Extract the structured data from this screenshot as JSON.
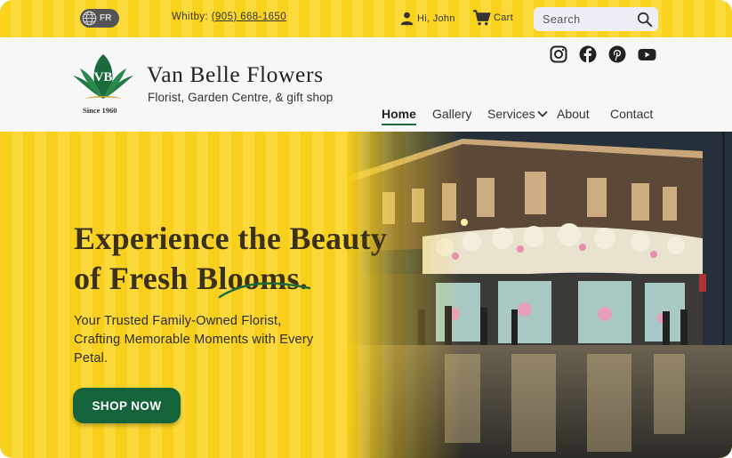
{
  "topbar": {
    "lang_label": "FR",
    "location": "Whitby:",
    "phone": "(905) 668-1650",
    "user_greeting": "Hi, John",
    "cart_label": "Cart",
    "search_placeholder": "Search"
  },
  "header": {
    "logo_initials": "VB",
    "since": "Since 1960",
    "brand": "Van Belle Flowers",
    "tagline": "Florist, Garden Centre, & gift shop",
    "socials": [
      "instagram-icon",
      "facebook-icon",
      "pinterest-icon",
      "youtube-icon"
    ]
  },
  "nav": {
    "items": [
      {
        "label": "Home",
        "active": true
      },
      {
        "label": "Gallery"
      },
      {
        "label": "Services"
      },
      {
        "label": "About"
      },
      {
        "label": "Contact"
      }
    ]
  },
  "hero": {
    "headline_line1": "Experience the Beauty",
    "headline_line2": "of Fresh Blooms.",
    "subtitle": "Your Trusted Family-Owned Florist, Crafting Memorable Moments with Every Petal.",
    "cta_label": "SHOP NOW"
  },
  "colors": {
    "accent_yellow": "#f8d21c",
    "brand_green": "#15633a",
    "text_dark": "#3a3118"
  }
}
